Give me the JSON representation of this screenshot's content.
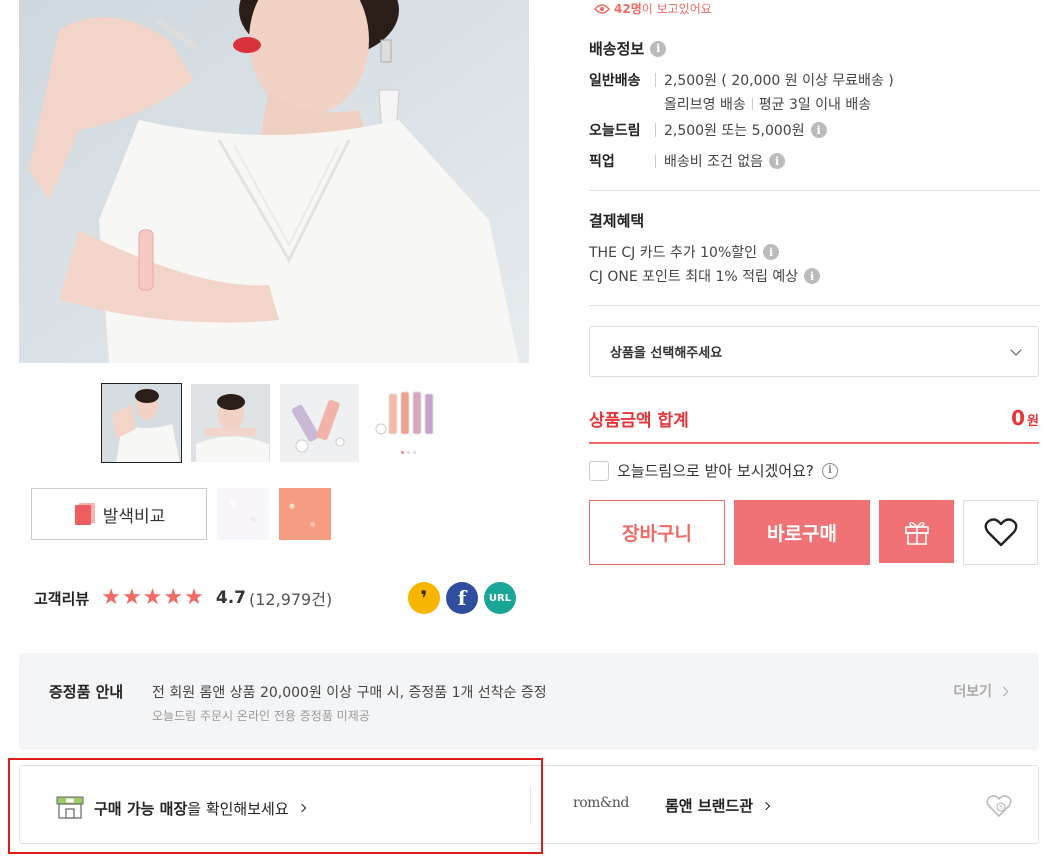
{
  "viewer": {
    "count": "42명",
    "text": "이 보고있어요"
  },
  "shipping": {
    "title": "배송정보",
    "rows": [
      {
        "key": "일반배송",
        "line1": "2,500원 ( 20,000 원 이상 무료배송 )",
        "line2a": "올리브영 배송",
        "line2b": "평균 3일 이내 배송"
      },
      {
        "key": "오늘드림",
        "line1": "2,500원 또는 5,000원"
      },
      {
        "key": "픽업",
        "line1": "배송비 조건 없음"
      }
    ]
  },
  "payment": {
    "title": "결제혜택",
    "lines": [
      "THE CJ 카드 추가 10%할인",
      "CJ ONE 포인트 최대 1% 적립 예상"
    ]
  },
  "select": {
    "placeholder": "상품을 선택해주세요"
  },
  "total": {
    "label": "상품금액 합계",
    "value": "0",
    "unit": "원"
  },
  "today_dream": {
    "label": "오늘드림으로 받아 보시겠어요?"
  },
  "actions": {
    "cart": "장바구니",
    "buy": "바로구매"
  },
  "compare": {
    "label": "발색비교"
  },
  "review": {
    "label": "고객리뷰",
    "score": "4.7",
    "count": "(12,979건)",
    "stars": 5
  },
  "share": {
    "fb": "f",
    "url": "URL"
  },
  "gift": {
    "title": "증정품 안내",
    "text": "전 회원 롬앤 상품 20,000원 이상 구매 시, 증정품 1개 선착순 증정",
    "sub": "오늘드림 주문시 온라인 전용 증정품 미제공",
    "more": "더보기"
  },
  "store": {
    "bold": "구매 가능 매장",
    "rest": "을 확인해보세요"
  },
  "brand": {
    "logo": "rom&nd",
    "link": "롬앤 브랜드관"
  },
  "colors": {
    "accent": "#f26a65",
    "accent_dark": "#e5363a",
    "highlight": "#e01b1b"
  }
}
